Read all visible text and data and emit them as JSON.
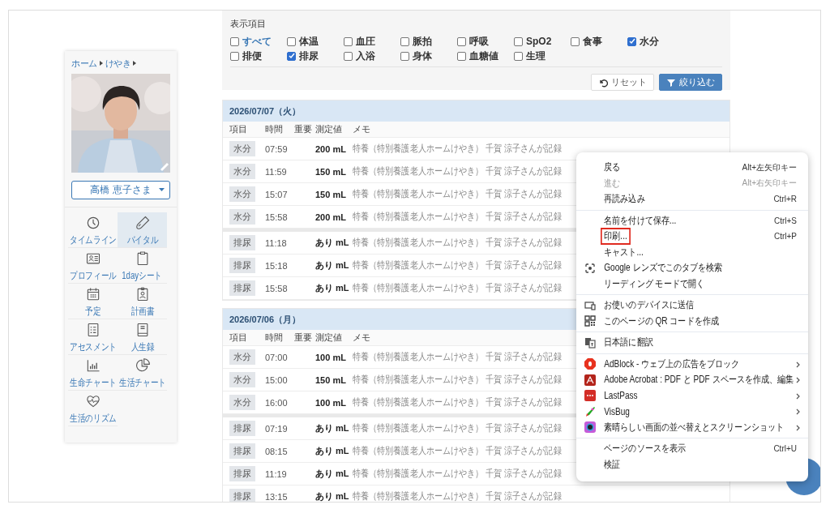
{
  "sidebar": {
    "breadcrumb": [
      "ホーム",
      "けやき"
    ],
    "photo": {
      "kind": "picture"
    },
    "resident": "高橋 恵子さま",
    "nav": [
      {
        "label": "タイムライン",
        "selected": false
      },
      {
        "label": "バイタル",
        "selected": true
      },
      {
        "label": "プロフィール",
        "selected": false
      },
      {
        "label": "1dayシート",
        "selected": false
      },
      {
        "label": "予定",
        "selected": false
      },
      {
        "label": "計画書",
        "selected": false
      },
      {
        "label": "アセスメント",
        "selected": false
      },
      {
        "label": "人生録",
        "selected": false
      },
      {
        "label": "生命チャート",
        "selected": false
      },
      {
        "label": "生活チャート",
        "selected": false
      },
      {
        "label": "生活のリズム",
        "selected": false
      }
    ]
  },
  "filter": {
    "title": "表示項目",
    "options": [
      {
        "label": "すべて",
        "checked": false
      },
      {
        "label": "体温",
        "checked": false
      },
      {
        "label": "血圧",
        "checked": false
      },
      {
        "label": "脈拍",
        "checked": false
      },
      {
        "label": "呼吸",
        "checked": false
      },
      {
        "label": "SpO2",
        "checked": false
      },
      {
        "label": "食事",
        "checked": false
      },
      {
        "label": "水分",
        "checked": true
      },
      {
        "label": "排便",
        "checked": false
      },
      {
        "label": "排尿",
        "checked": true
      },
      {
        "label": "入浴",
        "checked": false
      },
      {
        "label": "身体",
        "checked": false
      },
      {
        "label": "血糖値",
        "checked": false
      },
      {
        "label": "生理",
        "checked": false
      }
    ],
    "buttons": [
      "リセット",
      "絞り込む"
    ]
  },
  "sections": [
    {
      "date": "2026/07/07（火）",
      "columns": [
        "項目",
        "時間",
        "重要",
        "測定値",
        "メモ"
      ],
      "groups": [
        [
          {
            "item": "水分",
            "time": "07:59",
            "value": "200 mL",
            "memo": "特養（特別養護老人ホームけやき） 千賀 涼子さんが記録"
          },
          {
            "item": "水分",
            "time": "11:59",
            "value": "150 mL",
            "memo": "特養（特別養護老人ホームけやき） 千賀 涼子さんが記録"
          },
          {
            "item": "水分",
            "time": "15:07",
            "value": "150 mL",
            "memo": "特養（特別養護老人ホームけやき） 千賀 涼子さんが記録"
          },
          {
            "item": "水分",
            "time": "15:58",
            "value": "200 mL",
            "memo": "特養（特別養護老人ホームけやき） 千賀 涼子さんが記録"
          }
        ],
        [
          {
            "item": "排尿",
            "time": "11:18",
            "value": "あり mL",
            "memo": "特養（特別養護老人ホームけやき） 千賀 涼子さんが記録"
          },
          {
            "item": "排尿",
            "time": "15:18",
            "value": "あり mL",
            "memo": "特養（特別養護老人ホームけやき） 千賀 涼子さんが記録"
          },
          {
            "item": "排尿",
            "time": "15:58",
            "value": "あり mL",
            "memo": "特養（特別養護老人ホームけやき） 千賀 涼子さんが記録"
          }
        ]
      ]
    },
    {
      "date": "2026/07/06（月）",
      "columns": [
        "項目",
        "時間",
        "重要",
        "測定値",
        "メモ"
      ],
      "groups": [
        [
          {
            "item": "水分",
            "time": "07:00",
            "value": "100 mL",
            "memo": "特養（特別養護老人ホームけやき） 千賀 涼子さんが記録"
          },
          {
            "item": "水分",
            "time": "15:00",
            "value": "150 mL",
            "memo": "特養（特別養護老人ホームけやき） 千賀 涼子さんが記録"
          },
          {
            "item": "水分",
            "time": "16:00",
            "value": "100 mL",
            "memo": "特養（特別養護老人ホームけやき） 千賀 涼子さんが記録"
          }
        ],
        [
          {
            "item": "排尿",
            "time": "07:19",
            "value": "あり mL",
            "memo": "特養（特別養護老人ホームけやき） 千賀 涼子さんが記録"
          },
          {
            "item": "排尿",
            "time": "08:15",
            "value": "あり mL",
            "memo": "特養（特別養護老人ホームけやき） 千賀 涼子さんが記録"
          },
          {
            "item": "排尿",
            "time": "11:19",
            "value": "あり mL",
            "memo": "特養（特別養護老人ホームけやき） 千賀 涼子さんが記録"
          },
          {
            "item": "排尿",
            "time": "13:15",
            "value": "あり mL",
            "memo": "特養（特別養護老人ホームけやき） 千賀 涼子さんが記録"
          }
        ]
      ]
    }
  ],
  "context_menu": {
    "groups": [
      {
        "items": [
          {
            "label": "戻る",
            "shortcut": "Alt+左矢印キー",
            "disabled": false,
            "submenu": false,
            "annotated": false
          },
          {
            "label": "進む",
            "shortcut": "Alt+右矢印キー",
            "disabled": true,
            "submenu": false,
            "annotated": false
          },
          {
            "label": "再読み込み",
            "shortcut": "Ctrl+R",
            "disabled": false,
            "submenu": false,
            "annotated": false
          }
        ]
      },
      {
        "items": [
          {
            "label": "名前を付けて保存...",
            "shortcut": "Ctrl+S",
            "disabled": false,
            "submenu": false,
            "annotated": false
          },
          {
            "label": "印刷...",
            "shortcut": "Ctrl+P",
            "disabled": false,
            "submenu": false,
            "annotated": true
          },
          {
            "label": "キャスト...",
            "disabled": false,
            "submenu": false,
            "annotated": false
          },
          {
            "label": "Google レンズでこのタブを検索",
            "disabled": false,
            "submenu": false,
            "annotated": false
          },
          {
            "label": "リーディング モードで開く",
            "disabled": false,
            "submenu": false,
            "annotated": false
          }
        ]
      },
      {
        "items": [
          {
            "label": "お使いのデバイスに送信",
            "disabled": false,
            "submenu": false,
            "annotated": false
          },
          {
            "label": "このページの QR コードを作成",
            "disabled": false,
            "submenu": false,
            "annotated": false
          }
        ]
      },
      {
        "items": [
          {
            "label": "日本語に翻訳",
            "disabled": false,
            "submenu": false,
            "annotated": false
          }
        ]
      },
      {
        "items": [
          {
            "label": "AdBlock - ウェブ上の広告をブロック",
            "disabled": false,
            "submenu": true,
            "annotated": false
          },
          {
            "label": "Adobe Acrobat : PDF と PDF スペースを作成、編集",
            "disabled": false,
            "submenu": true,
            "annotated": false
          },
          {
            "label": "LastPass",
            "disabled": false,
            "submenu": true,
            "annotated": false
          },
          {
            "label": "VisBug",
            "disabled": false,
            "submenu": true,
            "annotated": false
          },
          {
            "label": "素晴らしい画面の並べ替えとスクリーンショット",
            "disabled": false,
            "submenu": true,
            "annotated": false
          }
        ]
      },
      {
        "items": [
          {
            "label": "ページのソースを表示",
            "shortcut": "Ctrl+U",
            "disabled": false,
            "submenu": false,
            "annotated": false
          },
          {
            "label": "検証",
            "disabled": false,
            "submenu": false,
            "annotated": false
          }
        ]
      }
    ]
  }
}
